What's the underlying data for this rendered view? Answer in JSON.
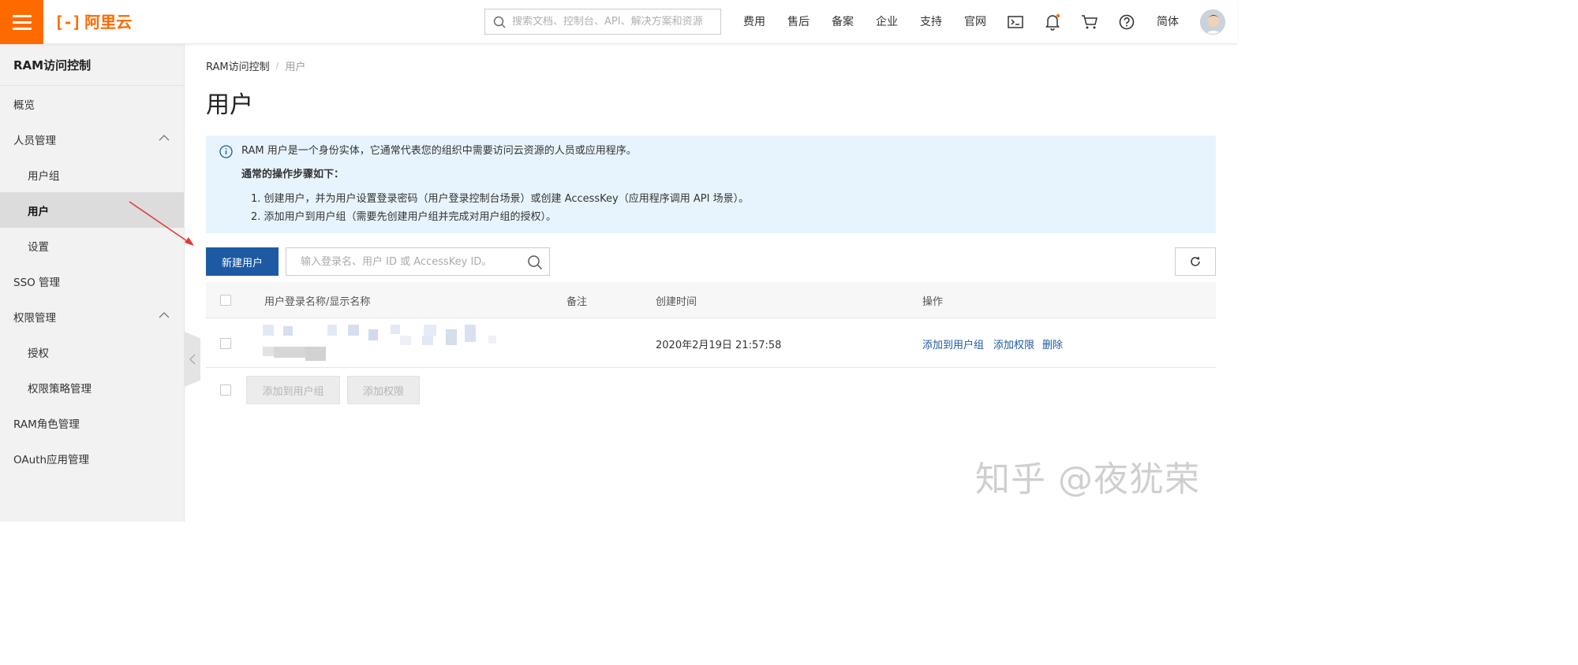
{
  "header": {
    "logo_text": "阿里云",
    "logo_mark": "[-]",
    "search_placeholder": "搜索文档、控制台、API、解决方案和资源",
    "nav": [
      "费用",
      "售后",
      "备案",
      "企业",
      "支持",
      "官网"
    ],
    "language": "简体",
    "accent_color": "#ff6a00",
    "icons": [
      "terminal-icon",
      "bell-icon",
      "cart-icon",
      "help-icon"
    ]
  },
  "sidebar": {
    "title": "RAM访问控制",
    "items": [
      {
        "label": "概览"
      },
      {
        "label": "人员管理"
      },
      {
        "label": "用户组"
      },
      {
        "label": "用户"
      },
      {
        "label": "设置"
      },
      {
        "label": "SSO 管理"
      },
      {
        "label": "权限管理"
      },
      {
        "label": "授权"
      },
      {
        "label": "权限策略管理"
      },
      {
        "label": "RAM角色管理"
      },
      {
        "label": "OAuth应用管理"
      }
    ]
  },
  "breadcrumb": {
    "root": "RAM访问控制",
    "sep": "/",
    "current": "用户"
  },
  "page": {
    "title": "用户"
  },
  "notice": {
    "line1": "RAM 用户是一个身份实体，它通常代表您的组织中需要访问云资源的人员或应用程序。",
    "heading": "通常的操作步骤如下：",
    "step1": "1. 创建用户，并为用户设置登录密码（用户登录控制台场景）或创建 AccessKey（应用程序调用 API 场景）。",
    "step2": "2. 添加用户到用户组（需要先创建用户组并完成对用户组的授权）。"
  },
  "toolbar": {
    "create_label": "新建用户",
    "search_placeholder": "输入登录名、用户 ID 或 AccessKey ID。"
  },
  "table": {
    "headers": [
      "用户登录名称/显示名称",
      "备注",
      "创建时间",
      "操作"
    ],
    "rows": [
      {
        "created": "2020年2月19日 21:57:58",
        "actions": [
          "添加到用户组",
          "添加权限",
          "删除"
        ]
      }
    ]
  },
  "batch": {
    "add_to_group": "添加到用户组",
    "add_permission": "添加权限"
  },
  "watermark": "知乎 @夜犹荣",
  "link_color": "#1e5aa3",
  "primary_color": "#1e5aa3"
}
